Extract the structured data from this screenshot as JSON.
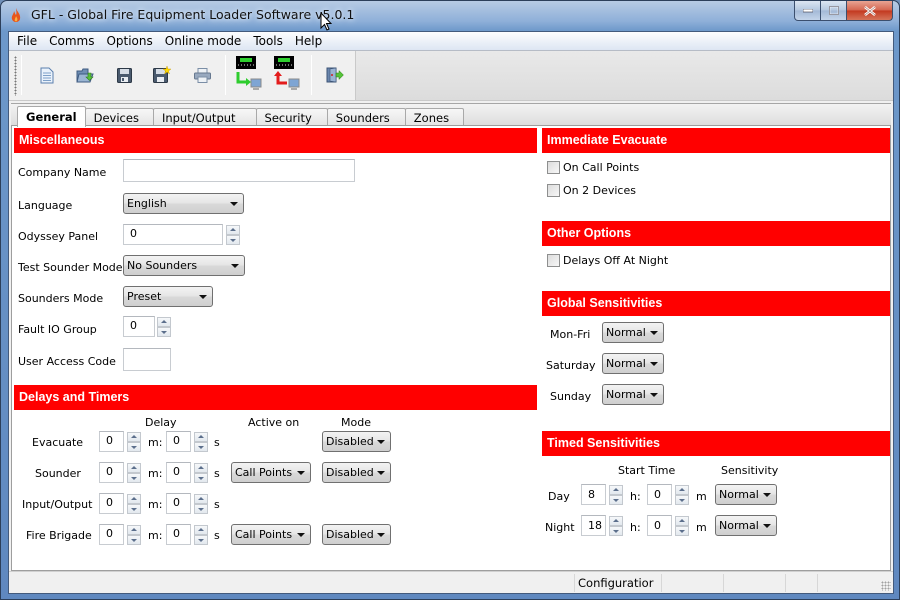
{
  "window": {
    "title": "GFL - Global Fire Equipment Loader Software v5.0.1",
    "controls": [
      "minimize",
      "maximize",
      "close"
    ]
  },
  "menu": [
    "File",
    "Comms",
    "Options",
    "Online mode",
    "Tools",
    "Help"
  ],
  "toolbar": [
    {
      "icon": "new-document-icon",
      "label": "New"
    },
    {
      "icon": "open-folder-icon",
      "label": "Open"
    },
    {
      "icon": "save-icon",
      "label": "Save"
    },
    {
      "icon": "save-as-icon",
      "label": "Save As"
    },
    {
      "icon": "print-icon",
      "label": "Print"
    },
    {
      "icon": "download-from-panel-icon",
      "label": "Download from panel"
    },
    {
      "icon": "upload-to-panel-icon",
      "label": "Upload to panel"
    },
    {
      "icon": "exit-icon",
      "label": "Exit"
    }
  ],
  "tabs": [
    {
      "label": "General",
      "active": true
    },
    {
      "label": "Devices",
      "active": false
    },
    {
      "label": "Input/Output",
      "active": false
    },
    {
      "label": "Security",
      "active": false
    },
    {
      "label": "Sounders",
      "active": false
    },
    {
      "label": "Zones",
      "active": false
    }
  ],
  "colors": {
    "section_header": "#ff0000"
  },
  "misc": {
    "header": "Miscellaneous",
    "company_name": {
      "label": "Company Name",
      "value": ""
    },
    "language": {
      "label": "Language",
      "value": "English"
    },
    "odyssey_panel": {
      "label": "Odyssey Panel",
      "value": "0"
    },
    "test_sounder_mode": {
      "label": "Test Sounder Mode",
      "value": "No Sounders"
    },
    "sounders_mode": {
      "label": "Sounders Mode",
      "value": "Preset"
    },
    "fault_io_group": {
      "label": "Fault IO Group",
      "value": "0"
    },
    "user_access_code": {
      "label": "User Access Code",
      "value": ""
    }
  },
  "delays": {
    "header": "Delays and Timers",
    "col_delay": "Delay",
    "col_active_on": "Active on",
    "col_mode": "Mode",
    "unit_m": "m:",
    "unit_s": "s",
    "rows": [
      {
        "label": "Evacuate",
        "minutes": "0",
        "seconds": "0",
        "active_on": null,
        "mode": "Disabled"
      },
      {
        "label": "Sounder",
        "minutes": "0",
        "seconds": "0",
        "active_on": "Call Points",
        "mode": "Disabled"
      },
      {
        "label": "Input/Output",
        "minutes": "0",
        "seconds": "0",
        "active_on": null,
        "mode": null
      },
      {
        "label": "Fire Brigade",
        "minutes": "0",
        "seconds": "0",
        "active_on": "Call Points",
        "mode": "Disabled"
      }
    ]
  },
  "immediate_evacuate": {
    "header": "Immediate Evacuate",
    "options": [
      {
        "label": "On Call Points",
        "checked": false
      },
      {
        "label": "On 2 Devices",
        "checked": false
      }
    ]
  },
  "other_options": {
    "header": "Other Options",
    "options": [
      {
        "label": "Delays Off At Night",
        "checked": false
      }
    ]
  },
  "global_sensitivities": {
    "header": "Global Sensitivities",
    "rows": [
      {
        "label": "Mon-Fri",
        "value": "Normal"
      },
      {
        "label": "Saturday",
        "value": "Normal"
      },
      {
        "label": "Sunday",
        "value": "Normal"
      }
    ]
  },
  "timed_sensitivities": {
    "header": "Timed Sensitivities",
    "col_start_time": "Start Time",
    "col_sensitivity": "Sensitivity",
    "unit_h": "h:",
    "unit_m": "m",
    "rows": [
      {
        "label": "Day",
        "hours": "8",
        "minutes": "0",
        "sensitivity": "Normal"
      },
      {
        "label": "Night",
        "hours": "18",
        "minutes": "0",
        "sensitivity": "Normal"
      }
    ]
  },
  "status_bar": {
    "segments": [
      "",
      "Configuratior",
      "",
      "",
      "",
      ""
    ]
  }
}
